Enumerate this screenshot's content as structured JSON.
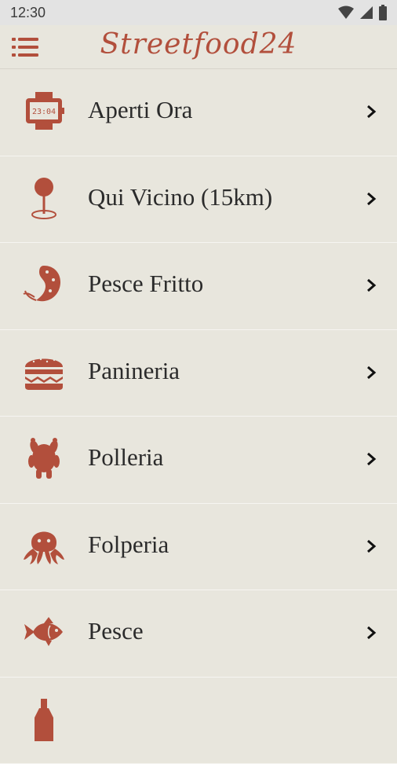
{
  "status_bar": {
    "time": "12:30"
  },
  "app_bar": {
    "title": "Streetfood24",
    "menu_icon": "hamburger-menu-icon"
  },
  "colors": {
    "accent": "#b24f3c",
    "background": "#e8e6dd",
    "text": "#2b2b2b"
  },
  "categories": [
    {
      "label": "Aperti Ora",
      "icon": "watch-icon"
    },
    {
      "label": "Qui Vicino (15km)",
      "icon": "map-pin-icon"
    },
    {
      "label": "Pesce Fritto",
      "icon": "fried-shrimp-icon"
    },
    {
      "label": "Panineria",
      "icon": "burger-icon"
    },
    {
      "label": "Polleria",
      "icon": "roast-chicken-icon"
    },
    {
      "label": "Folperia",
      "icon": "octopus-icon"
    },
    {
      "label": "Pesce",
      "icon": "fish-icon"
    },
    {
      "label": "",
      "icon": "bottle-icon"
    }
  ]
}
